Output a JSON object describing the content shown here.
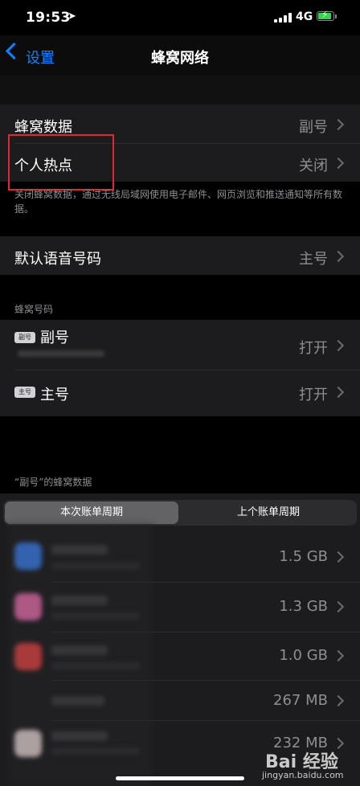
{
  "status_bar": {
    "time": "19:53",
    "network": "4G"
  },
  "nav": {
    "back_label": "设置",
    "title": "蜂窝网络"
  },
  "main": {
    "cellular_data": {
      "label": "蜂窝数据",
      "value": "副号"
    },
    "hotspot": {
      "label": "个人热点",
      "value": "关闭"
    },
    "note": "关闭蜂窝数据，通过无线局域网使用电子邮件、网页浏览和推送通知等所有数据。",
    "default_voice": {
      "label": "默认语音号码",
      "value": "主号"
    }
  },
  "numbers_section": {
    "header": "蜂窝号码",
    "items": [
      {
        "badge": "副号",
        "label": "副号",
        "value": "打开"
      },
      {
        "badge": "主号",
        "label": "主号",
        "value": "打开"
      }
    ]
  },
  "usage_section": {
    "header": "“副号”的蜂窝数据",
    "tabs": [
      "本次账单周期",
      "上个账单周期"
    ],
    "apps": [
      {
        "value": "1.5 GB",
        "color": "#3b82f6"
      },
      {
        "value": "1.3 GB",
        "color": "#f472b6"
      },
      {
        "value": "1.0 GB",
        "color": "#ef4444"
      },
      {
        "value": "267 MB",
        "color": "#1c1c1e"
      },
      {
        "value": "232 MB",
        "color": "#f5e1e1"
      }
    ]
  },
  "watermark": {
    "brand": "Bai 经验",
    "url": "jingyan.baidu.com"
  }
}
